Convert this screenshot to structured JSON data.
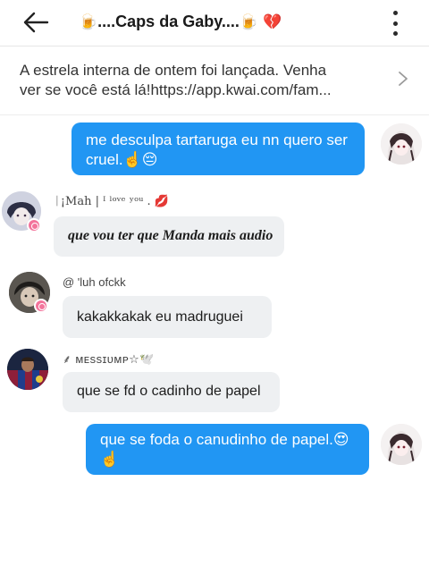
{
  "header": {
    "title": "🍺....Caps da Gaby....🍺 💔",
    "title_emoji_left": "🍺",
    "title_text": "....Caps da Gaby....",
    "title_emoji_right": "🍺",
    "title_emoji_heart": "💔"
  },
  "announcement": {
    "line1": "A estrela interna de ontem foi lançada. Venha",
    "line2": "ver se você está lá!https://app.kwai.com/fam..."
  },
  "messages": [
    {
      "direction": "out",
      "text": "me desculpa tartaruga eu nn quero ser cruel.☝️😔"
    },
    {
      "direction": "in",
      "sender": "ᛁ¡Mah | ᴵ ˡᵒᵛᵉ ʸᵒᵘ . 💋",
      "text": "que vou ter que Manda mais audio"
    },
    {
      "direction": "in",
      "sender": "@ 'luh ofckk",
      "text": "kakakkakak eu madruguei"
    },
    {
      "direction": "in",
      "sender": "⸙ ᴍᴇssɪᴜᴍᴘ☆🕊️",
      "text": "que se fd o cadinho de papel"
    },
    {
      "direction": "out",
      "text": "que se foda o canudinho de papel.😍☝️"
    }
  ],
  "colors": {
    "outgoing_bubble": "#2196f3",
    "incoming_bubble": "#eef0f2",
    "badge": "#f3739b"
  }
}
